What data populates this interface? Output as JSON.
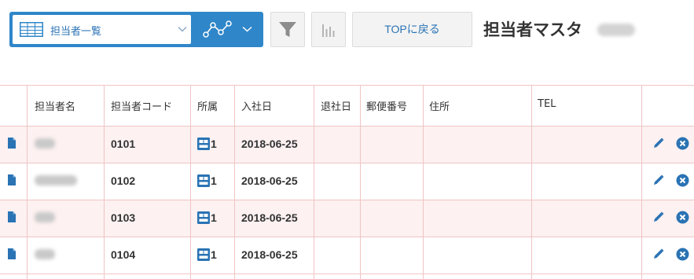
{
  "toolbar": {
    "view_selector_label": "担当者一覧",
    "top_button_label": "TOPに戻る",
    "page_title": "担当者マスタ"
  },
  "colors": {
    "accent_blue": "#2f86c9",
    "row_pink": "#fdf1f1",
    "grid_line": "#f0c4c4"
  },
  "icons": {
    "view": "table-icon",
    "graph": "line-graph-icon",
    "filter": "funnel-icon",
    "chart": "bar-chart-icon",
    "record": "document-icon",
    "department": "dept-card-icon",
    "edit": "pencil-icon",
    "delete": "close-circle-icon"
  },
  "table": {
    "columns": [
      "担当者名",
      "担当者コード",
      "所属",
      "入社日",
      "退社日",
      "郵便番号",
      "住所",
      "TEL"
    ],
    "rows": [
      {
        "code": "0101",
        "department_count": "1",
        "hire_date": "2018-06-25"
      },
      {
        "code": "0102",
        "department_count": "1",
        "hire_date": "2018-06-25"
      },
      {
        "code": "0103",
        "department_count": "1",
        "hire_date": "2018-06-25"
      },
      {
        "code": "0104",
        "department_count": "1",
        "hire_date": "2018-06-25"
      }
    ]
  }
}
